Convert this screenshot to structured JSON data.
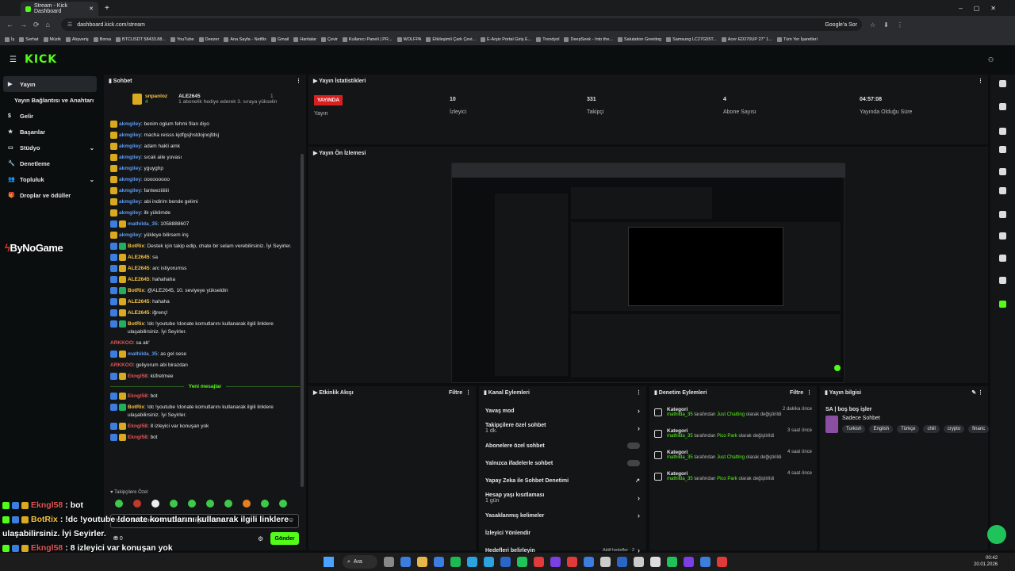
{
  "browser": {
    "tab_title": "Stream - Kick Dashboard",
    "url": "dashboard.kick.com/stream",
    "profile_label": "Google'a Sor"
  },
  "bookmarks": [
    "İş",
    "Serhat",
    "Müzik",
    "Alışveriş",
    "Borsa",
    "BTCUSDT 58433.88...",
    "YouTube",
    "Deezer",
    "Ana Sayfa - Netflix",
    "Gmail",
    "Haritalar",
    "Çevir",
    "Kullanıcı Paneli | PR...",
    "WOLFPA",
    "Etkileşimli Çark Çevi...",
    "E-Arşiv Portal Giriş E...",
    "Trendyol",
    "DeepSeek - Into the...",
    "Salutation Greeting",
    "Samsung LC27G55T...",
    "Acer ED270UP 27\" 1...",
    "Tüm Yer İşaretleri"
  ],
  "logo": "KICK",
  "nav": [
    {
      "label": "Yayın",
      "active": true
    },
    {
      "label": "Yayın Bağlantısı ve Anahtarı"
    },
    {
      "label": "Gelir"
    },
    {
      "label": "Başarılar"
    },
    {
      "label": "Stüdyo"
    },
    {
      "label": "Denetleme"
    },
    {
      "label": "Topluluk"
    },
    {
      "label": "Droplar ve ödüller"
    }
  ],
  "overlay_logo": "ByNoGame",
  "chat": {
    "title": "Sohbet",
    "top_user": "snpanloz",
    "top_count": "4",
    "top_gifter": "ALE2645",
    "top_gift_count": "1",
    "gift_note": "1 abonelik hediye ederek 3. sıraya yükselin",
    "new_messages": "Yeni mesajlar",
    "followers_only": "Takipçilere Özel",
    "input_text": "!ddonate komutlarını kullanarak ilgili linklere",
    "send": "Gönder",
    "count": "0",
    "messages": [
      {
        "user": "akmgiley",
        "text": "benim oglum fehmi filan diyo",
        "color": "#5b9bf5"
      },
      {
        "user": "akmgiley",
        "text": "macha reisss kjdfgsjhstdojnojfdsj",
        "color": "#5b9bf5"
      },
      {
        "user": "akmgiley",
        "text": "adam hakli amk",
        "color": "#5b9bf5"
      },
      {
        "user": "akmgiley",
        "text": "sıcak aile yuvası",
        "color": "#5b9bf5"
      },
      {
        "user": "akmgiley",
        "text": "yguyghp",
        "color": "#5b9bf5"
      },
      {
        "user": "akmgiley",
        "text": "ooooooooo",
        "color": "#5b9bf5"
      },
      {
        "user": "akmgiley",
        "text": "fanteeziiiiiii",
        "color": "#5b9bf5"
      },
      {
        "user": "akmgiley",
        "text": "abi indirim bende gelimi",
        "color": "#5b9bf5"
      },
      {
        "user": "akmgiley",
        "text": "ilk yüklimde",
        "color": "#5b9bf5"
      },
      {
        "user": "mathilda_35",
        "text": "1058888607",
        "color": "#5b9bf5"
      },
      {
        "user": "akmgiley",
        "text": "yükleye bilirsem inş",
        "color": "#5b9bf5"
      },
      {
        "user": "BotRix",
        "text": "Destek için takip edip, chate bir selam verebilirsiniz. İyi Seyirler.",
        "color": "#f5c242"
      },
      {
        "user": "ALE2645",
        "text": "sa",
        "color": "#f5c242"
      },
      {
        "user": "ALE2645",
        "text": "arc istiyorumss",
        "color": "#f5c242"
      },
      {
        "user": "ALE2645",
        "text": "hahahaha",
        "color": "#f5c242"
      },
      {
        "user": "BotRix",
        "text": "@ALE2645, 10. seviyeye yükseldin",
        "color": "#f5c242"
      },
      {
        "user": "ALE2645",
        "text": "hahaha",
        "color": "#f5c242"
      },
      {
        "user": "ALE2645",
        "text": "iğrenç!",
        "color": "#f5c242"
      },
      {
        "user": "BotRix",
        "text": "!dc !youtube !donate komutlarını kullanarak ilgili linklere ulaşabilirsiniz. İyi Seyirler.",
        "color": "#f5c242"
      },
      {
        "user": "ARKKOO",
        "text": "sa ab'",
        "color": "#e05555"
      },
      {
        "user": "mathilda_35",
        "text": "as gel sese",
        "color": "#5b9bf5"
      },
      {
        "user": "ARKKOO",
        "text": "geliyorum abi birazdan",
        "color": "#e05555"
      },
      {
        "user": "Ekngl58",
        "text": "küfretmee",
        "color": "#e05555"
      }
    ],
    "new_msgs": [
      {
        "user": "Ekngl58",
        "text": "bot",
        "color": "#e05555"
      },
      {
        "user": "BotRix",
        "text": "!dc !youtube !donate komutlarını kullanarak ilgili linklere ulaşabilirsiniz. İyi Seyirler.",
        "color": "#f5c242"
      },
      {
        "user": "Ekngl58",
        "text": "8 izleyici var konuşan yok",
        "color": "#e05555"
      },
      {
        "user": "Ekngl58",
        "text": "bot",
        "color": "#e05555"
      }
    ]
  },
  "stats": {
    "title": "Yayın İstatistikleri",
    "live": "YAYINDA",
    "live_label": "Yayın",
    "viewers": "10",
    "viewers_label": "İzleyici",
    "followers": "331",
    "followers_label": "Takipçi",
    "subs": "4",
    "subs_label": "Abone Sayısı",
    "uptime": "04:57:08",
    "uptime_label": "Yayında Olduğu Süre"
  },
  "preview_title": "Yayın Ön İzlemesi",
  "activity": {
    "title": "Etkinlik Akışı",
    "filter": "Filtre"
  },
  "channel_actions": {
    "title": "Kanal Eylemleri",
    "items": [
      {
        "label": "Yavaş mod",
        "type": "chev"
      },
      {
        "label": "Takipçilere özel sohbet",
        "sub": "1 dk.",
        "type": "chev"
      },
      {
        "label": "Abonelere özel sohbet",
        "type": "toggle"
      },
      {
        "label": "Yalnızca ifadelerle sohbet",
        "type": "toggle"
      },
      {
        "label": "Yapay Zeka ile Sohbet Denetimi",
        "type": "ext"
      },
      {
        "label": "Hesap yaşı kısıtlaması",
        "sub": "1 gün",
        "type": "chev"
      },
      {
        "label": "Yasaklanmış kelimeler",
        "type": "chev"
      },
      {
        "label": "İzleyici Yönlendir",
        "type": "none"
      },
      {
        "label": "Hedefleri belirleyin",
        "extra": "Aktif hedefler · 2",
        "type": "chev"
      }
    ]
  },
  "mod_actions": {
    "title": "Denetim Eylemleri",
    "filter": "Filtre",
    "items": [
      {
        "head": "Kategori",
        "time": "2 dakika önce",
        "user": "mathilda_35",
        "mid": "tarafından",
        "cat": "Just Chatting",
        "tail": "olarak değiştirildi"
      },
      {
        "head": "Kategori",
        "time": "3 saat önce",
        "user": "mathilda_35",
        "mid": "tarafından",
        "cat": "Pico Park",
        "tail": "olarak değiştirildi"
      },
      {
        "head": "Kategori",
        "time": "4 saat önce",
        "user": "mathilda_35",
        "mid": "tarafından",
        "cat": "Just Chatting",
        "tail": "olarak değiştirildi"
      },
      {
        "head": "Kategori",
        "time": "4 saat önce",
        "user": "mathilda_35",
        "mid": "tarafından",
        "cat": "Pico Park",
        "tail": "olarak değiştirildi"
      }
    ]
  },
  "stream_info": {
    "title": "Yayın bilgisi",
    "stream_title": "SA | boş boş işler",
    "category": "Sadece Sohbet",
    "tags": [
      "Turkish",
      "English",
      "Türkçe",
      "chill",
      "crypto",
      "financ"
    ]
  },
  "overlay_chat": [
    {
      "user": "Ekngl58",
      "text": ": bot",
      "color": "#e05555"
    },
    {
      "user": "BotRix",
      "text": ": !dc !youtube !donate komutlarını kullanarak ilgili linklere",
      "color": "#f5c242"
    },
    {
      "user": "",
      "text": "ulaşabilirsiniz. İyi Seyirler.",
      "color": "#fff"
    },
    {
      "user": "Ekngl58",
      "text": ": 8 izleyici var konuşan yok",
      "color": "#e05555"
    },
    {
      "user": "Ekngl58",
      "text": ": bot",
      "color": "#e05555"
    }
  ],
  "taskbar": {
    "search": "Ara",
    "time": "00:42",
    "date": "20.01.2026"
  }
}
